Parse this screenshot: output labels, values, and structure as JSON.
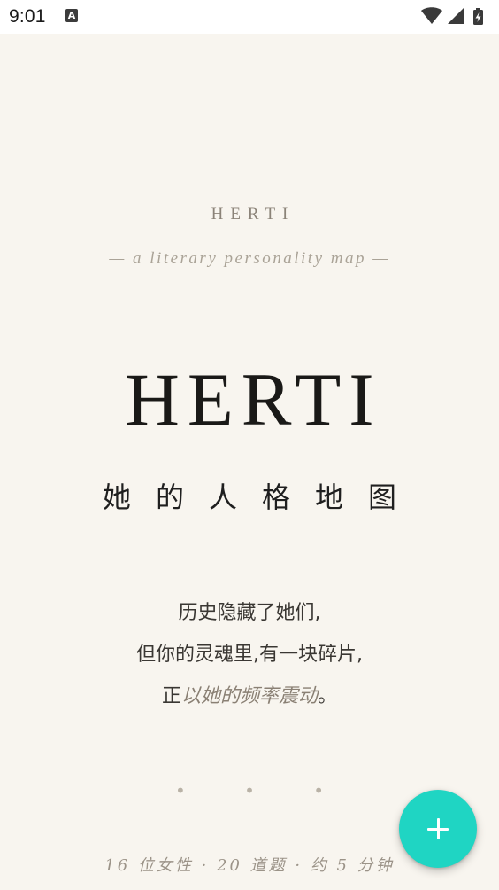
{
  "status_bar": {
    "time": "9:01",
    "app_icon_letter": "A",
    "icons": [
      "wifi-icon",
      "cellular-signal-icon",
      "battery-charging-icon"
    ]
  },
  "brand": {
    "small_title": "HERTI",
    "tagline": "— a literary personality map —",
    "large_title": "HERTI",
    "subtitle_cn": "她的人格地图"
  },
  "poem": {
    "line1": "历史隐藏了她们,",
    "line2": "但你的灵魂里,有一块碎片,",
    "line3_prefix": "正",
    "line3_emphasis": "以她的频率震动",
    "line3_suffix": "。"
  },
  "pager": {
    "dots": "• • •"
  },
  "footer": {
    "info": "16 位女性 · 20 道题 · 约 5 分钟"
  },
  "fab": {
    "icon": "plus-icon"
  },
  "colors": {
    "background": "#f8f5ef",
    "accent": "#1fd5c3",
    "text_primary": "#1a1917",
    "text_muted": "#9b9388"
  }
}
